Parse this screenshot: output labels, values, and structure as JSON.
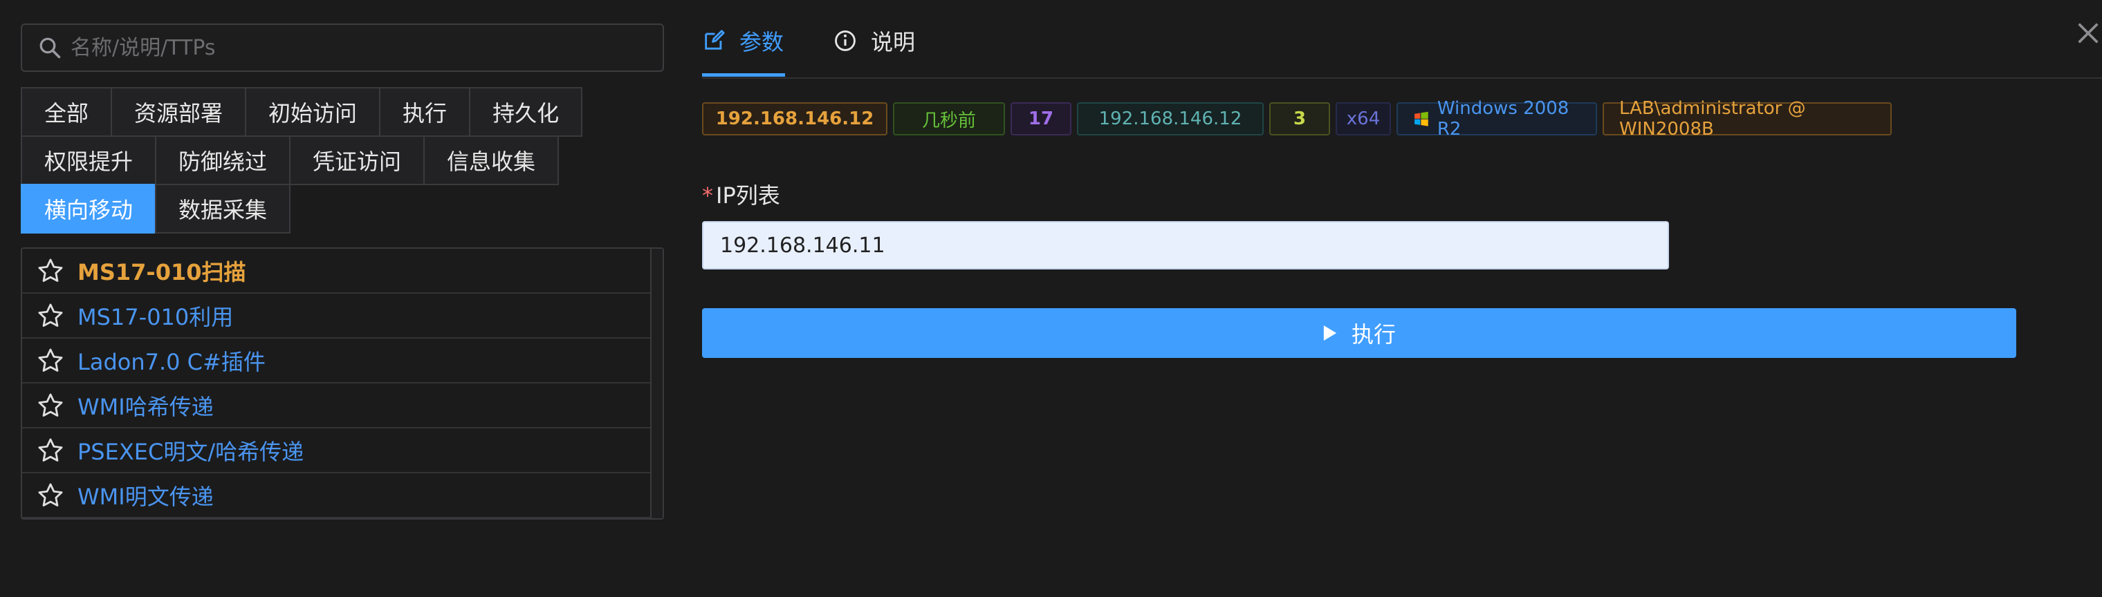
{
  "search": {
    "placeholder": "名称/说明/TTPs"
  },
  "categories": {
    "row1": [
      "全部",
      "资源部署",
      "初始访问",
      "执行",
      "持久化"
    ],
    "row2": [
      "权限提升",
      "防御绕过",
      "凭证访问",
      "信息收集"
    ],
    "row3": [
      "横向移动",
      "数据采集"
    ],
    "active": "横向移动"
  },
  "plugins": [
    {
      "label": "MS17-010扫描",
      "highlighted": true
    },
    {
      "label": "MS17-010利用",
      "highlighted": false
    },
    {
      "label": "Ladon7.0 C#插件",
      "highlighted": false
    },
    {
      "label": "WMI哈希传递",
      "highlighted": false
    },
    {
      "label": "PSEXEC明文/哈希传递",
      "highlighted": false
    },
    {
      "label": "WMI明文传递",
      "highlighted": false
    }
  ],
  "header": {
    "tab_params": "参数",
    "tab_desc": "说明"
  },
  "session_tags": {
    "ip": "192.168.146.12",
    "time": "几秒前",
    "pid": "17",
    "internal_ip": "192.168.146.12",
    "count": "3",
    "arch": "x64",
    "os": "Windows 2008 R2",
    "user": "LAB\\administrator @ WIN2008B"
  },
  "tag_colors": {
    "ip": "#e6a23c",
    "time": "#67c23a",
    "pid": "#a06ee8",
    "internal_ip": "#5fb3b3",
    "count": "#c8d84a",
    "arch": "#6a73d8",
    "os": "#4a95f0",
    "user": "#e6a23c"
  },
  "form": {
    "ip_list_label": "IP列表",
    "required_mark": "*",
    "ip_list_value": "192.168.146.11"
  },
  "actions": {
    "execute_label": "执行"
  },
  "theme": {
    "accent": "#409eff",
    "background": "#1b1b1c"
  }
}
